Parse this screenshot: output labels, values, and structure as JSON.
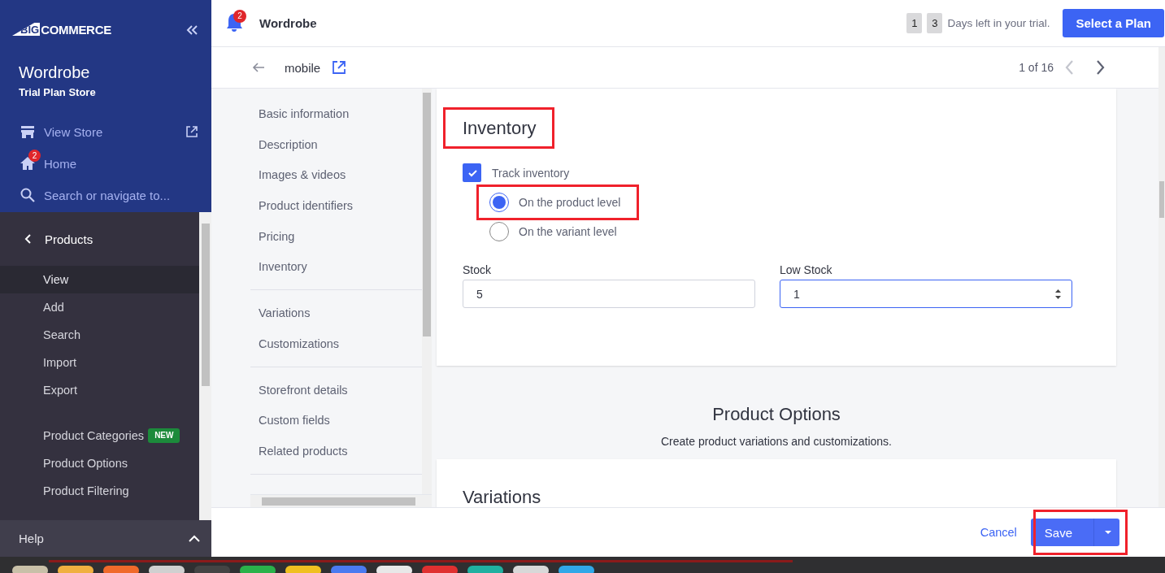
{
  "sidebar": {
    "logo": {
      "part_1": "BIG",
      "part_2": "COMMERCE"
    },
    "store_name": "Wordrobe",
    "store_plan": "Trial Plan Store",
    "links": [
      {
        "kind": "view-store",
        "label": "View Store"
      },
      {
        "kind": "home",
        "label": "Home",
        "badge": "2"
      },
      {
        "kind": "search",
        "label": "Search or navigate to..."
      }
    ],
    "section": "Products",
    "nav_groups": [
      [
        {
          "label": "View",
          "selected": true
        },
        {
          "label": "Add",
          "selected": false
        },
        {
          "label": "Search",
          "selected": false
        },
        {
          "label": "Import",
          "selected": false
        },
        {
          "label": "Export",
          "selected": false
        }
      ],
      [
        {
          "label": "Product Categories",
          "badge": "NEW",
          "selected": false
        },
        {
          "label": "Product Options",
          "selected": false
        },
        {
          "label": "Product Filtering",
          "selected": false
        }
      ]
    ],
    "help": "Help"
  },
  "topbar": {
    "notification_count": "2",
    "store_name": "Wordrobe",
    "trial_digits": [
      "1",
      "3"
    ],
    "trial_text": "Days left in your trial.",
    "plan_button": "Select a Plan"
  },
  "subheader": {
    "title": "mobile",
    "pager": "1 of 16"
  },
  "section_nav": [
    [
      "Basic information",
      "Description",
      "Images & videos",
      "Product identifiers",
      "Pricing",
      "Inventory"
    ],
    [
      "Variations",
      "Customizations"
    ],
    [
      "Storefront details",
      "Custom fields",
      "Related products"
    ]
  ],
  "inventory": {
    "heading": "Inventory",
    "track": {
      "label": "Track inventory",
      "checked": true
    },
    "levels": [
      {
        "label": "On the product level",
        "selected": true
      },
      {
        "label": "On the variant level",
        "selected": false
      }
    ],
    "fields": [
      {
        "kind": "text",
        "label": "Stock",
        "value": "5",
        "focused": false
      },
      {
        "kind": "number",
        "label": "Low Stock",
        "value": "1",
        "focused": true
      }
    ]
  },
  "product_options": {
    "title": "Product Options",
    "subtitle": "Create product variations and customizations."
  },
  "variations": {
    "heading": "Variations"
  },
  "footer": {
    "cancel": "Cancel",
    "save": "Save"
  }
}
